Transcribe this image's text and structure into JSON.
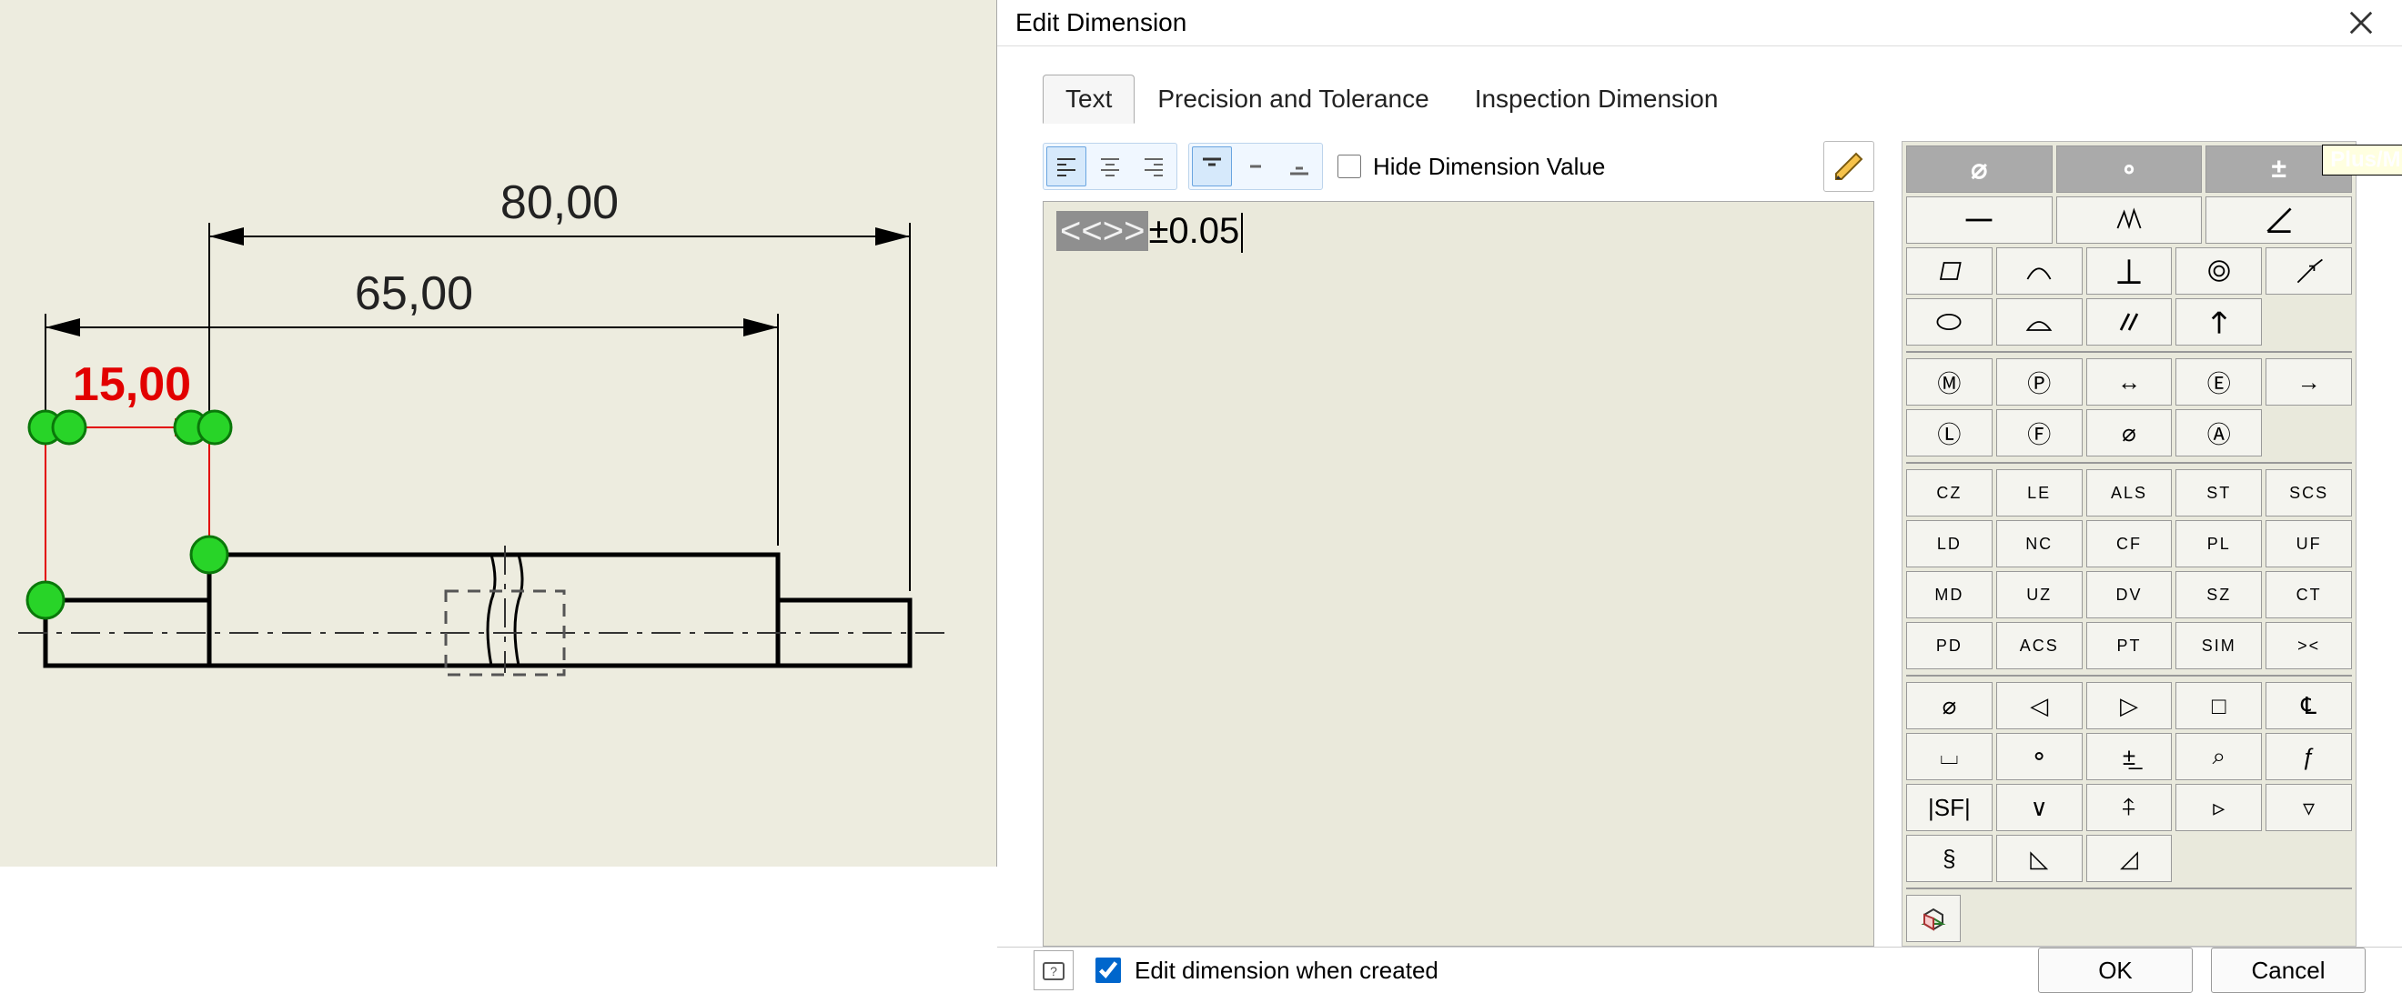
{
  "dialog": {
    "title": "Edit Dimension",
    "close_icon": "close",
    "tabs": [
      "Text",
      "Precision and Tolerance",
      "Inspection Dimension"
    ],
    "active_tab": 0,
    "hide_dim_label": "Hide Dimension Value",
    "editor_placeholder": "<<>>",
    "editor_appended": "±0.05",
    "tooltip": "Plus/Minus",
    "palette_head": [
      "⌀",
      "∘",
      "±"
    ],
    "palette_rows_svg_desc": [
      [
        "line",
        "breakline",
        "angle-sym"
      ],
      [
        "parallelogram",
        "arc",
        "perpendicular",
        "double-circle",
        "3d-arrow"
      ],
      [
        "ellipse",
        "surface-arc",
        "double-slash",
        "up-arrow",
        ""
      ]
    ],
    "palette_mods": [
      [
        "Ⓜ",
        "Ⓟ",
        "↔",
        "Ⓔ",
        "→"
      ],
      [
        "Ⓛ",
        "Ⓕ",
        "⌀",
        "Ⓐ",
        ""
      ]
    ],
    "palette_text": [
      [
        "CZ",
        "LE",
        "ALS",
        "ST",
        "SCS"
      ],
      [
        "LD",
        "NC",
        "CF",
        "PL",
        "UF"
      ],
      [
        "MD",
        "UZ",
        "DV",
        "SZ",
        "CT"
      ],
      [
        "PD",
        "ACS",
        "PT",
        "SIM",
        "><"
      ]
    ],
    "palette_geo": [
      [
        "⌀",
        "◁",
        "▷",
        "□",
        "℄"
      ],
      [
        "⌴",
        "⚬",
        "±̲",
        "⌕",
        "ƒ"
      ],
      [
        "|SF|",
        "∨",
        "⍏",
        "▹",
        "▿"
      ],
      [
        "§",
        "◺",
        "◿",
        "",
        ""
      ]
    ],
    "palette_last": "◆",
    "edit_when_created": "Edit dimension when created",
    "ok": "OK",
    "cancel": "Cancel",
    "help_icon": "?"
  },
  "drawing": {
    "dim_80": "80,00",
    "dim_65": "65,00",
    "dim_15": "15,00"
  }
}
